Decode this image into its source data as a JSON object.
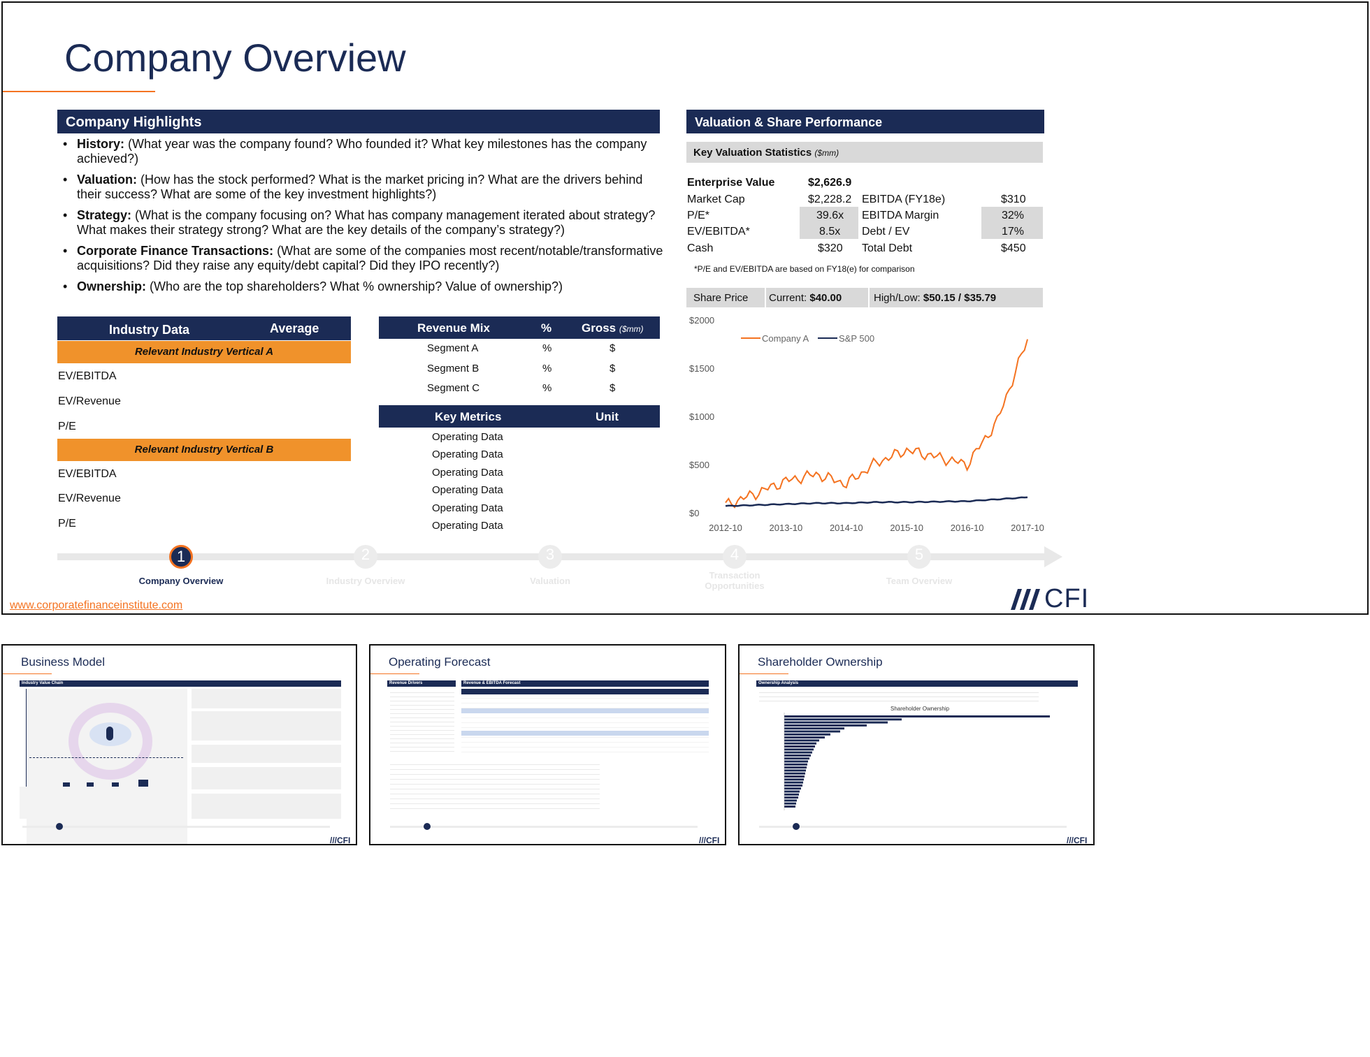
{
  "main_slide": {
    "title": "Company Overview",
    "highlights": {
      "header": "Company Highlights",
      "items": [
        {
          "label": "History:",
          "text": " (What year was the company found? Who founded it? What key milestones has the company achieved?)"
        },
        {
          "label": "Valuation:",
          "text": " (How has the stock performed? What is the market pricing in? What are the drivers behind their success? What are some of the key investment highlights?)"
        },
        {
          "label": "Strategy:",
          "text": " (What is the company focusing on? What has company management iterated about strategy? What makes their strategy strong? What are the key details of the company’s strategy?)"
        },
        {
          "label": "Corporate Finance Transactions:",
          "text": " (What are some of the companies most recent/notable/transformative acquisitions? Did they raise any equity/debt capital? Did they IPO recently?)"
        },
        {
          "label": "Ownership:",
          "text": " (Who are the top shareholders? What % ownership? Value of ownership?)"
        }
      ]
    },
    "industry": {
      "col1": "Industry Data",
      "col2": "Average",
      "vertical_a": "Relevant Industry Vertical A",
      "vertical_b": "Relevant Industry Vertical B",
      "metrics_a": [
        "EV/EBITDA",
        "EV/Revenue",
        "P/E"
      ],
      "metrics_b": [
        "EV/EBITDA",
        "EV/Revenue",
        "P/E"
      ]
    },
    "revenue_mix": {
      "col1": "Revenue Mix",
      "col2": "%",
      "col3": "Gross",
      "col3_unit": "($mm)",
      "rows": [
        {
          "name": "Segment A",
          "pct": "%",
          "gross": "$"
        },
        {
          "name": "Segment B",
          "pct": "%",
          "gross": "$"
        },
        {
          "name": "Segment C",
          "pct": "%",
          "gross": "$"
        }
      ]
    },
    "key_metrics": {
      "col1": "Key Metrics",
      "col2": "Unit",
      "rows": [
        "Operating Data",
        "Operating Data",
        "Operating Data",
        "Operating Data",
        "Operating Data",
        "Operating Data"
      ]
    },
    "valuation": {
      "header": "Valuation & Share Performance",
      "stats_title": "Key Valuation Statistics",
      "stats_unit": "($mm)",
      "ev_label": "Enterprise Value",
      "ev_value": "$2,626.9",
      "left": [
        {
          "label": "Market Cap",
          "value": "$2,228.2"
        },
        {
          "label": "P/E*",
          "value": "39.6x"
        },
        {
          "label": "EV/EBITDA*",
          "value": "8.5x"
        },
        {
          "label": "Cash",
          "value": "$320"
        }
      ],
      "right": [
        {
          "label": "EBITDA (FY18e)",
          "value": "$310"
        },
        {
          "label": "EBITDA Margin",
          "value": "32%"
        },
        {
          "label": "Debt / EV",
          "value": "17%"
        },
        {
          "label": "Total Debt",
          "value": "$450"
        }
      ],
      "footnote": "*P/E and EV/EBITDA are based on FY18(e) for comparison",
      "share_price_label": "Share Price",
      "current_label": "Current:",
      "current_value": "$40.00",
      "highlow_label": "High/Low:",
      "highlow_value": "$50.15 / $35.79"
    },
    "progress": {
      "steps": [
        {
          "num": "1",
          "label": "Company Overview",
          "active": true
        },
        {
          "num": "2",
          "label": "Industry Overview",
          "active": false
        },
        {
          "num": "3",
          "label": "Valuation",
          "active": false
        },
        {
          "num": "4",
          "label": "Transaction Opportunities",
          "active": false
        },
        {
          "num": "5",
          "label": "Team Overview",
          "active": false
        }
      ]
    },
    "website": "www.corporatefinanceinstitute.com",
    "logo_text": "CFI"
  },
  "chart_data": {
    "type": "line",
    "x": [
      "2012-10",
      "2013-04",
      "2013-10",
      "2014-04",
      "2014-10",
      "2015-04",
      "2015-10",
      "2016-04",
      "2016-10",
      "2017-04",
      "2017-10"
    ],
    "series": [
      {
        "name": "Company A",
        "values": [
          80,
          200,
          330,
          400,
          300,
          520,
          650,
          580,
          500,
          950,
          1800
        ]
      },
      {
        "name": "S&P 500",
        "values": [
          70,
          80,
          90,
          100,
          100,
          110,
          110,
          115,
          120,
          140,
          160
        ]
      }
    ],
    "yticks": [
      "$0",
      "$500",
      "$1000",
      "$1500",
      "$2000"
    ],
    "xticks": [
      "2012-10",
      "2013-10",
      "2014-10",
      "2015-10",
      "2016-10",
      "2017-10"
    ],
    "ylim": [
      0,
      2000
    ],
    "legend": "top-left",
    "colors": {
      "Company A": "#f47321",
      "S&P 500": "#1b2b55"
    }
  },
  "thumbnails": [
    {
      "title": "Business Model",
      "section": "Industry Value Chain"
    },
    {
      "title": "Operating Forecast",
      "section_left": "Revenue Drivers",
      "section_right": "Revenue & EBITDA Forecast"
    },
    {
      "title": "Shareholder Ownership",
      "section": "Ownership Analysis",
      "chart_title": "Shareholder Ownership"
    }
  ],
  "colors": {
    "navy": "#1b2b55",
    "orange": "#f0922b",
    "accent": "#f47321",
    "gray": "#d9d9d9"
  }
}
